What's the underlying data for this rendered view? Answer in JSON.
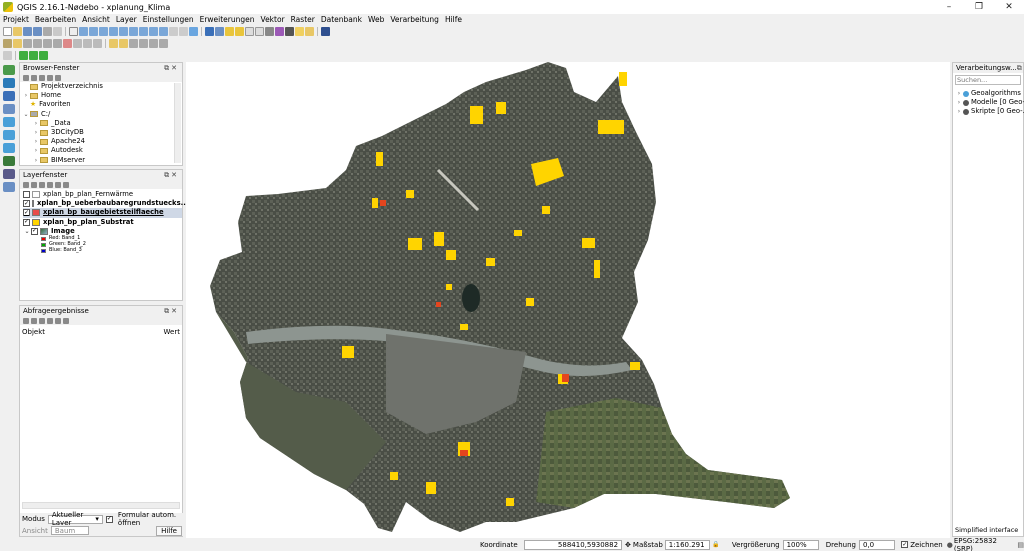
{
  "window": {
    "title": "QGIS 2.16.1-Nødebo - xplanung_Klima",
    "controls": [
      "–",
      "❐",
      "✕"
    ]
  },
  "menu": [
    "Projekt",
    "Bearbeiten",
    "Ansicht",
    "Layer",
    "Einstellungen",
    "Erweiterungen",
    "Vektor",
    "Raster",
    "Datenbank",
    "Web",
    "Verarbeitung",
    "Hilfe"
  ],
  "browser": {
    "title": "Browser-Fenster",
    "items": [
      "Projektverzeichnis",
      "Home",
      "Favoriten",
      "C:/",
      "_Data",
      "3DCityDB",
      "Apache24",
      "Autodesk",
      "BIMserver"
    ]
  },
  "layers": {
    "title": "Layerfenster",
    "items": [
      "xplan_bp_plan_Fernwärme",
      "xplan_bp_ueberbaubaregrundstuecks...",
      "xplan_bp_baugebietsteilflaeche",
      "xplan_bp_plan_Substrat",
      "Image"
    ],
    "bands": [
      "Red: Band_1",
      "Green: Band_2",
      "Blue: Band_3"
    ]
  },
  "query": {
    "title": "Abfrageergebnisse",
    "col_object": "Objekt",
    "col_value": "Wert",
    "mode_label": "Modus",
    "mode_value": "Aktueller Layer",
    "auto_open": "Formular autom. öffnen",
    "view_label": "Ansicht",
    "view_value": "Baum",
    "help": "Hilfe"
  },
  "processing": {
    "title": "Verarbeitungsw...",
    "search_placeholder": "Suchen...",
    "items": [
      "Geoalgorithms",
      "Modelle [0 Geo-...",
      "Skripte [0 Geo-..."
    ],
    "simplified": "Simplified interface"
  },
  "status": {
    "coord_label": "Koordinate",
    "coord_value": "588410,5930882",
    "scale_label": "Maßstab",
    "scale_value": "1:160.291",
    "mag_label": "Vergrößerung",
    "mag_value": "100%",
    "rot_label": "Drehung",
    "rot_value": "0,0",
    "render_label": "Zeichnen",
    "epsg": "EPSG:25832 (SRP)"
  }
}
